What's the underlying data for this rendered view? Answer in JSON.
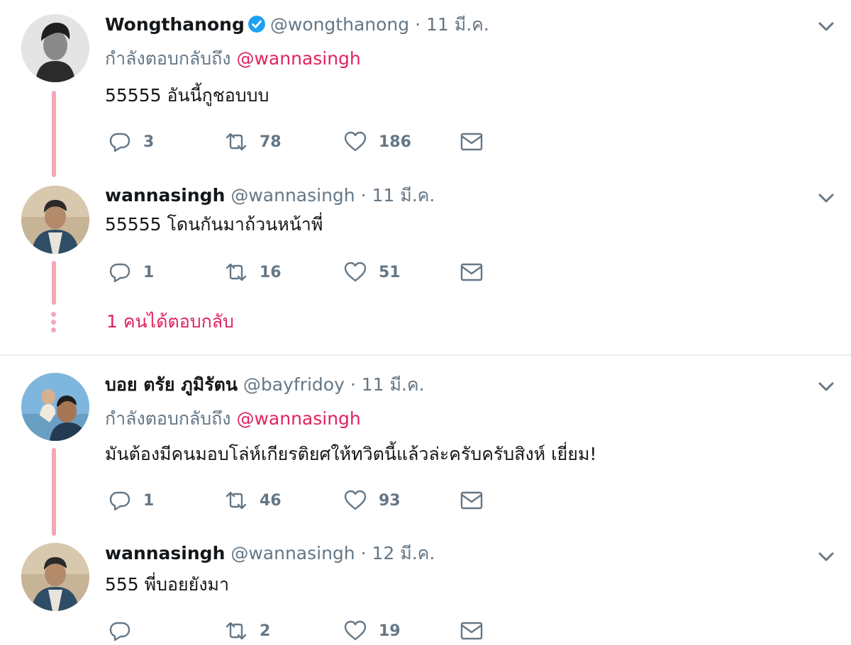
{
  "tweets": [
    {
      "name": "Wongthanong",
      "verified": true,
      "handle": "@wongthanong",
      "dot": "·",
      "time": "11 มี.ค.",
      "replying_label": "กำลังตอบกลับถึง",
      "replying_to": "@wannasingh",
      "text": "55555 อันนี้กูชอบบบ",
      "replies": "3",
      "retweets": "78",
      "likes": "186"
    },
    {
      "name": "wannasingh",
      "verified": false,
      "handle": "@wannasingh",
      "dot": "·",
      "time": "11 มี.ค.",
      "text": "55555 โดนกันมาถ้วนหน้าพี่",
      "replies": "1",
      "retweets": "16",
      "likes": "51"
    },
    {
      "name": "บอย ตรัย ภูมิรัตน",
      "verified": false,
      "handle": "@bayfridoy",
      "dot": "·",
      "time": "11 มี.ค.",
      "replying_label": "กำลังตอบกลับถึง",
      "replying_to": "@wannasingh",
      "text": "มันต้องมีคนมอบโล่ห์เกียรติยศให้ทวิตนี้แล้วล่ะครับครับสิงห์ เยี่ยม!",
      "replies": "1",
      "retweets": "46",
      "likes": "93"
    },
    {
      "name": "wannasingh",
      "verified": false,
      "handle": "@wannasingh",
      "dot": "·",
      "time": "12 มี.ค.",
      "text": "555 พี่บอยยังมา",
      "replies": "",
      "retweets": "2",
      "likes": "19"
    }
  ],
  "thread": {
    "more_replies": "1 คนได้ตอบกลับ"
  },
  "icons": {
    "reply": "reply-icon",
    "retweet": "retweet-icon",
    "like": "heart-icon",
    "dm": "envelope-icon",
    "caret": "chevron-down-icon",
    "verified": "verified-badge-icon"
  },
  "colors": {
    "mention": "#e0245e",
    "thread_line": "#f3a9b5",
    "muted": "#657786",
    "verified": "#1da1f2"
  }
}
